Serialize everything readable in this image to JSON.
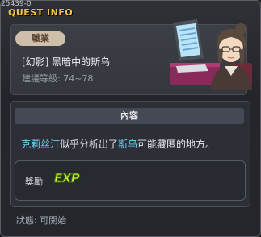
{
  "window": {
    "quest_id": "25439-0",
    "title": "QUEST INFO"
  },
  "info": {
    "job_label": "職業",
    "quest_name": "[幻影] 黑暗中的斯乌",
    "level_text": "建議等級: 74~78"
  },
  "content": {
    "header": "內容",
    "text_parts": {
      "npc1": "克莉丝汀",
      "mid1": "似乎分析出了",
      "npc2": "斯乌",
      "mid2": "可能藏匿的地方。"
    }
  },
  "reward": {
    "label": "獎勵",
    "exp_text": "EXP"
  },
  "status": {
    "text": "狀態: 可開始"
  },
  "colors": {
    "title": "#f2c24a",
    "highlight": "#6fd3f5",
    "exp": "#d8f23a"
  }
}
